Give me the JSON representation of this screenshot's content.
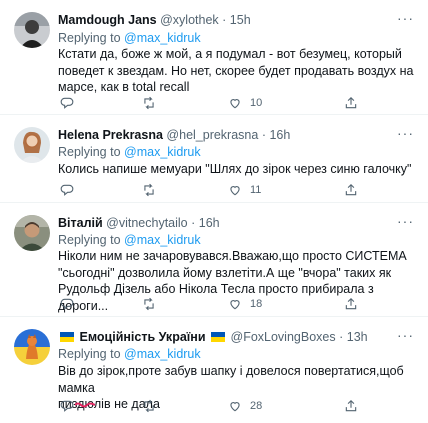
{
  "tweets": [
    {
      "name": "Mamdough Jans",
      "handle": "@xylothek",
      "time": "15h",
      "reply_prefix": "Replying to",
      "reply_user": "@max_kidruk",
      "text": "Кстати да, боже ж мой, а я подумал - вот безумец, который поведет к звездам. Но нет, скорее будет продавать воздух на марсе, как в total recall",
      "reply_count": "",
      "retweet_count": "",
      "like_count": "10"
    },
    {
      "name": "Helena Prekrasna",
      "handle": "@hel_prekrasna",
      "time": "16h",
      "reply_prefix": "Replying to",
      "reply_user": "@max_kidruk",
      "text": "Колись напише мемуари \"Шлях до зірок через синю галочку\"",
      "reply_count": "",
      "retweet_count": "",
      "like_count": "11"
    },
    {
      "name": "Віталій",
      "handle": "@vitnechytailo",
      "time": "16h",
      "reply_prefix": "Replying to",
      "reply_user": "@max_kidruk",
      "text": "Ніколи ним не зачаровувався.Вважаю,що просто СИСТЕМА \"сьогодні\" дозволила йому взлетіти.А ще \"вчора\" таких як Рудольф Дізель або Нікола Тесла просто прибирала з дороги...",
      "reply_count": "",
      "retweet_count": "",
      "like_count": "18"
    },
    {
      "name": "Емоційність України",
      "handle": "@FoxLovingBoxes",
      "time": "13h",
      "reply_prefix": "Replying to",
      "reply_user": "@max_kidruk",
      "text_line1": "Вів до зірок,проте забув шапку і довелося повертатися,щоб мамка",
      "text_start": "пиз",
      "text_redacted": "дю",
      "text_end": "лів не дала",
      "reply_count": "",
      "retweet_count": "",
      "like_count": "28"
    }
  ],
  "sep": "·",
  "more_glyph": "···",
  "colors": {
    "link": "#1d9bf0",
    "secondary": "#536471",
    "flag_blue": "#0057b7",
    "flag_yellow": "#ffd700"
  }
}
